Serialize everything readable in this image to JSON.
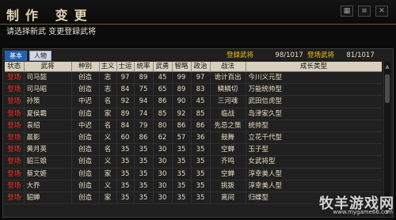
{
  "header": {
    "title": "制作 变更",
    "prompt": "请选择新武 变更登録武将"
  },
  "tabs": [
    {
      "label": "基本"
    },
    {
      "label": "人物"
    }
  ],
  "counters": {
    "registered_label": "登録武将",
    "registered_value": "98/1017",
    "appear_label": "登场武将",
    "appear_value": "81/1017"
  },
  "table": {
    "columns": [
      "状态",
      "武将",
      "种别",
      "主义",
      "士运",
      "统率",
      "武勇",
      "智略",
      "政治",
      "战法",
      "成长类型"
    ],
    "rows": [
      [
        "登场",
        "司马懿",
        "创造",
        "志",
        "97",
        "89",
        "45",
        "99",
        "97",
        "诡计百出",
        "今川义元型"
      ],
      [
        "登场",
        "司马昭",
        "创造",
        "志",
        "84",
        "75",
        "65",
        "89",
        "83",
        "鳞鳞切",
        "万能统帅型"
      ],
      [
        "登场",
        "孙策",
        "中迟",
        "名",
        "92",
        "94",
        "86",
        "90",
        "45",
        "三河魂",
        "武田信虎型"
      ],
      [
        "登场",
        "夏侯霸",
        "创造",
        "家",
        "89",
        "74",
        "85",
        "92",
        "85",
        "临战",
        "岛津家久型"
      ],
      [
        "登场",
        "袁绍",
        "中迟",
        "名",
        "84",
        "79",
        "80",
        "86",
        "86",
        "先忌之策",
        "统帅型"
      ],
      [
        "登场",
        "晨影",
        "创造",
        "义",
        "60",
        "86",
        "62",
        "57",
        "36",
        "鼓舞",
        "立花千代型"
      ],
      [
        "登场",
        "黄月英",
        "创造",
        "名",
        "35",
        "35",
        "30",
        "35",
        "35",
        "空蝉",
        "玉子型"
      ],
      [
        "登场",
        "貂三娘",
        "创造",
        "义",
        "35",
        "35",
        "30",
        "35",
        "35",
        "齐鸣",
        "女武将型"
      ],
      [
        "登场",
        "蔡文姬",
        "创造",
        "家",
        "35",
        "35",
        "30",
        "35",
        "35",
        "空蝉",
        "淳幸美人型"
      ],
      [
        "登场",
        "大乔",
        "创造",
        "义",
        "35",
        "35",
        "30",
        "35",
        "35",
        "挑拨",
        "淳幸美人型"
      ],
      [
        "登场",
        "貂蝉",
        "创造",
        "家",
        "35",
        "35",
        "30",
        "35",
        "35",
        "离间",
        "归蝶型"
      ]
    ]
  },
  "watermark": {
    "text": "牧羊游戏网",
    "url": "www.mygame66.com"
  }
}
